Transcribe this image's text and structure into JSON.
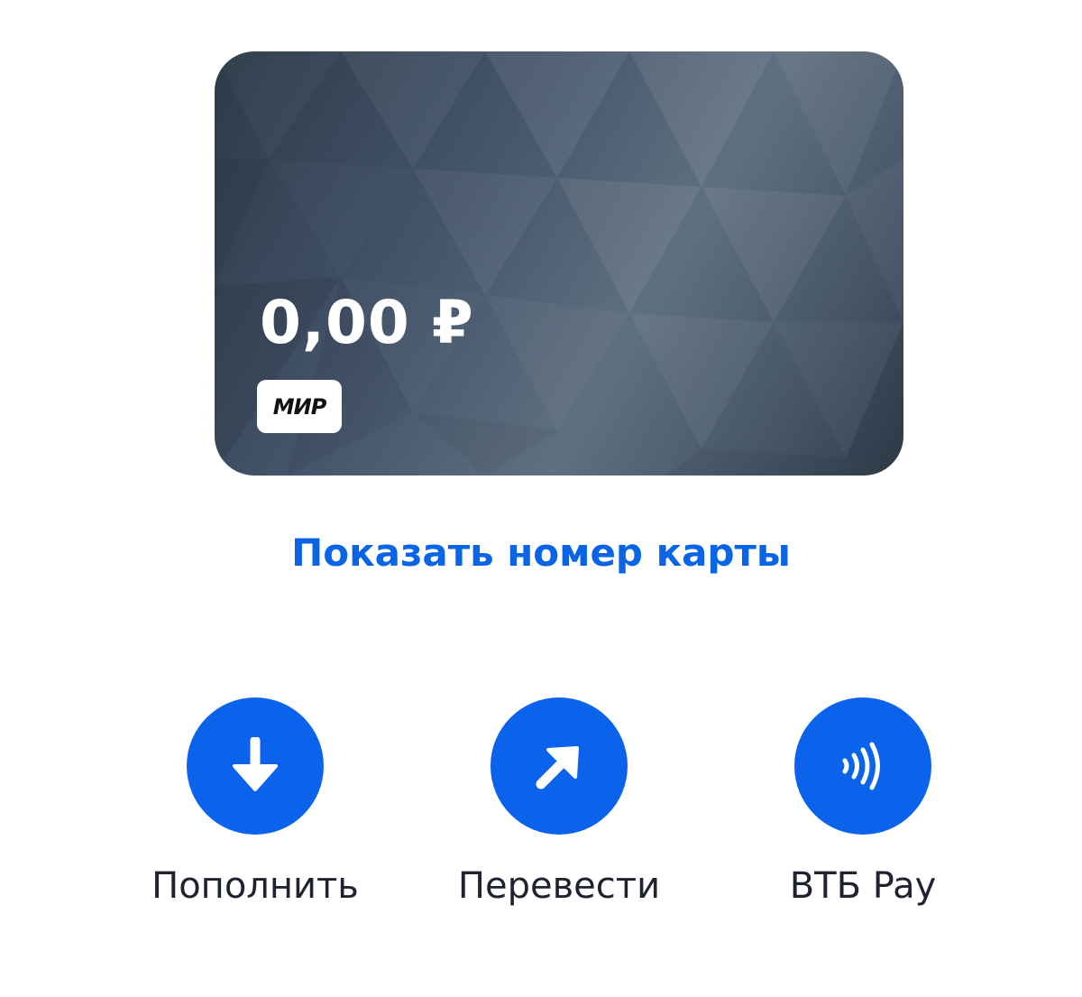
{
  "card": {
    "balance": "0,00 ₽",
    "payment_system": "МИР"
  },
  "show_card_number_label": "Показать номер карты",
  "actions": [
    {
      "label": "Пополнить",
      "icon": "arrow-down-icon"
    },
    {
      "label": "Перевести",
      "icon": "arrow-up-right-icon"
    },
    {
      "label": "ВТБ Pay",
      "icon": "contactless-icon"
    }
  ],
  "colors": {
    "accent": "#0b63ec",
    "link": "#0a64e6",
    "card_dark": "#2c3a48",
    "card_light": "#5f7080",
    "text": "#1f2330"
  }
}
